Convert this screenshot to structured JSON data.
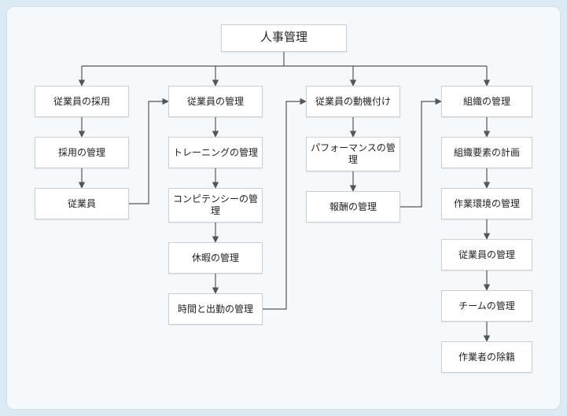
{
  "chart_data": {
    "type": "tree",
    "title": "人事管理",
    "root": "人事管理",
    "branches": [
      {
        "head": "従業員の採用",
        "chain": [
          "採用の管理",
          "従業員"
        ],
        "cross_to": "従業員の管理"
      },
      {
        "head": "従業員の管理",
        "chain": [
          "トレーニングの管理",
          "コンピテンシーの管理",
          "休暇の管理",
          "時間と出勤の管理"
        ],
        "cross_to": "従業員の動機付け"
      },
      {
        "head": "従業員の動機付け",
        "chain": [
          "パフォーマンスの管理",
          "報酬の管理"
        ],
        "cross_to": "組織の管理"
      },
      {
        "head": "組織の管理",
        "chain": [
          "組織要素の計画",
          "作業環境の管理",
          "従業員の管理",
          "チームの管理",
          "作業者の除籍"
        ]
      }
    ]
  },
  "nodes": {
    "root": "人事管理",
    "c1": "従業員の採用",
    "c1a": "採用の管理",
    "c1b": "従業員",
    "c2": "従業員の管理",
    "c2a": "トレーニングの管理",
    "c2b": "コンピテンシーの管理",
    "c2c": "休暇の管理",
    "c2d": "時間と出勤の管理",
    "c3": "従業員の動機付け",
    "c3a": "パフォーマンスの管理",
    "c3b": "報酬の管理",
    "c4": "組織の管理",
    "c4a": "組織要素の計画",
    "c4b": "作業環境の管理",
    "c4c": "従業員の管理",
    "c4d": "チームの管理",
    "c4e": "作業者の除籍"
  }
}
